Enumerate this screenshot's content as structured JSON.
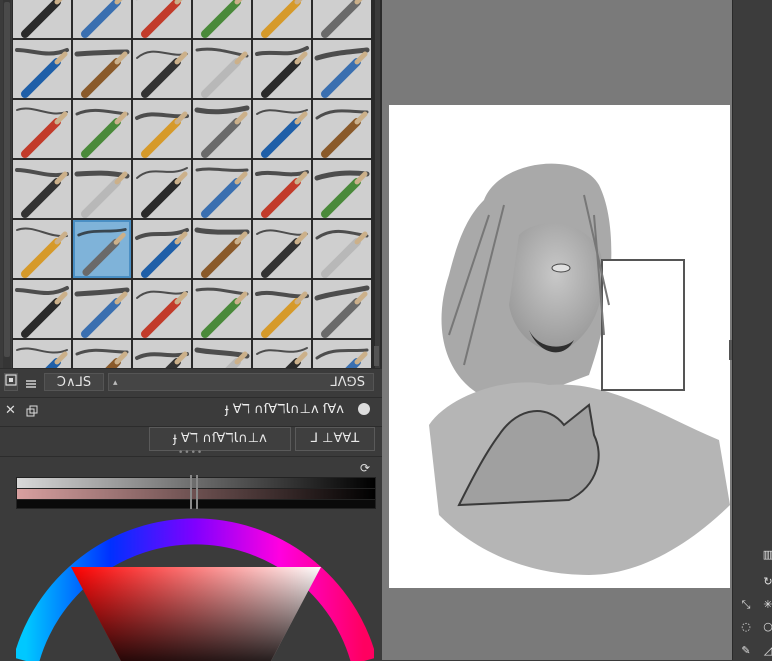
{
  "brush_panel": {
    "search_value": "Ɔ∧⅃S",
    "preset_name": "ɟ ∀ℸ ∩ſ∀ℸƖ∩⊥ʌ ſ∀ʌ",
    "tab_left": "ɟ ∀ℸ ∩ſ∀ℸƖ∩⊥ʌ",
    "tab_right": "⅃ ⊥∀∀ꓕ"
  },
  "colors": {
    "panel_bg": "#3b3b3b",
    "canvas_bg": "#7a7a7a",
    "selected_tile": "#7fb3d9",
    "tile_bg": "#cfcfcf"
  },
  "icons": {
    "view_mode": "grid-view-icon",
    "list_mode": "list-view-icon",
    "close": "close-icon",
    "float": "float-icon",
    "refresh": "refresh-icon"
  }
}
